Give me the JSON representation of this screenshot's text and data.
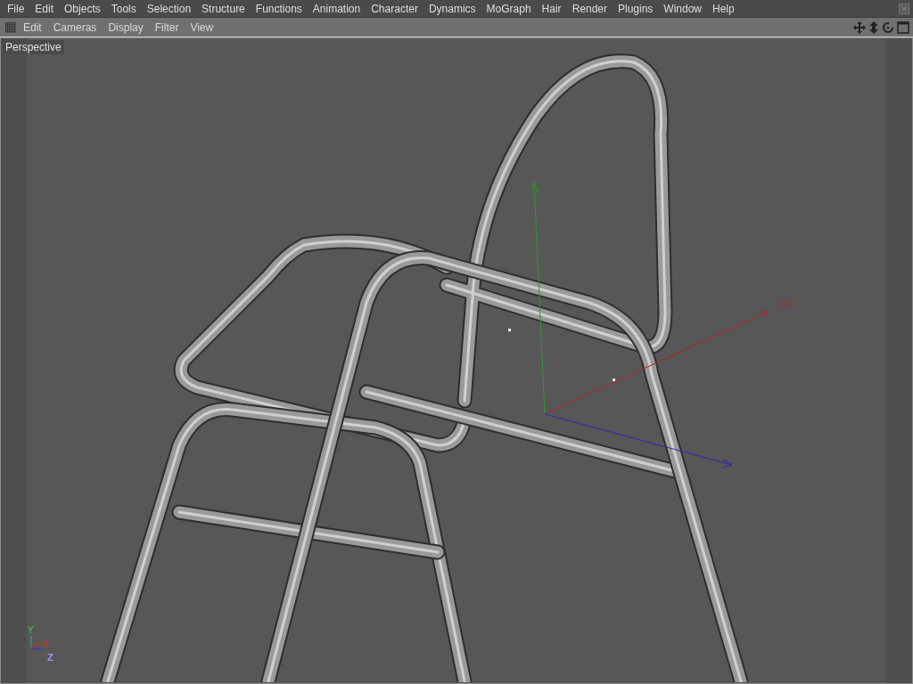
{
  "menu_bar": {
    "items": [
      "File",
      "Edit",
      "Objects",
      "Tools",
      "Selection",
      "Structure",
      "Functions",
      "Animation",
      "Character",
      "Dynamics",
      "MoGraph",
      "Hair",
      "Render",
      "Plugins",
      "Window",
      "Help"
    ]
  },
  "viewport_toolbar": {
    "items": [
      "Edit",
      "Cameras",
      "Display",
      "Filter",
      "View"
    ]
  },
  "viewport": {
    "camera_label": "Perspective",
    "axis_labels": {
      "y": "Y",
      "x": "X",
      "z": "Z"
    }
  }
}
